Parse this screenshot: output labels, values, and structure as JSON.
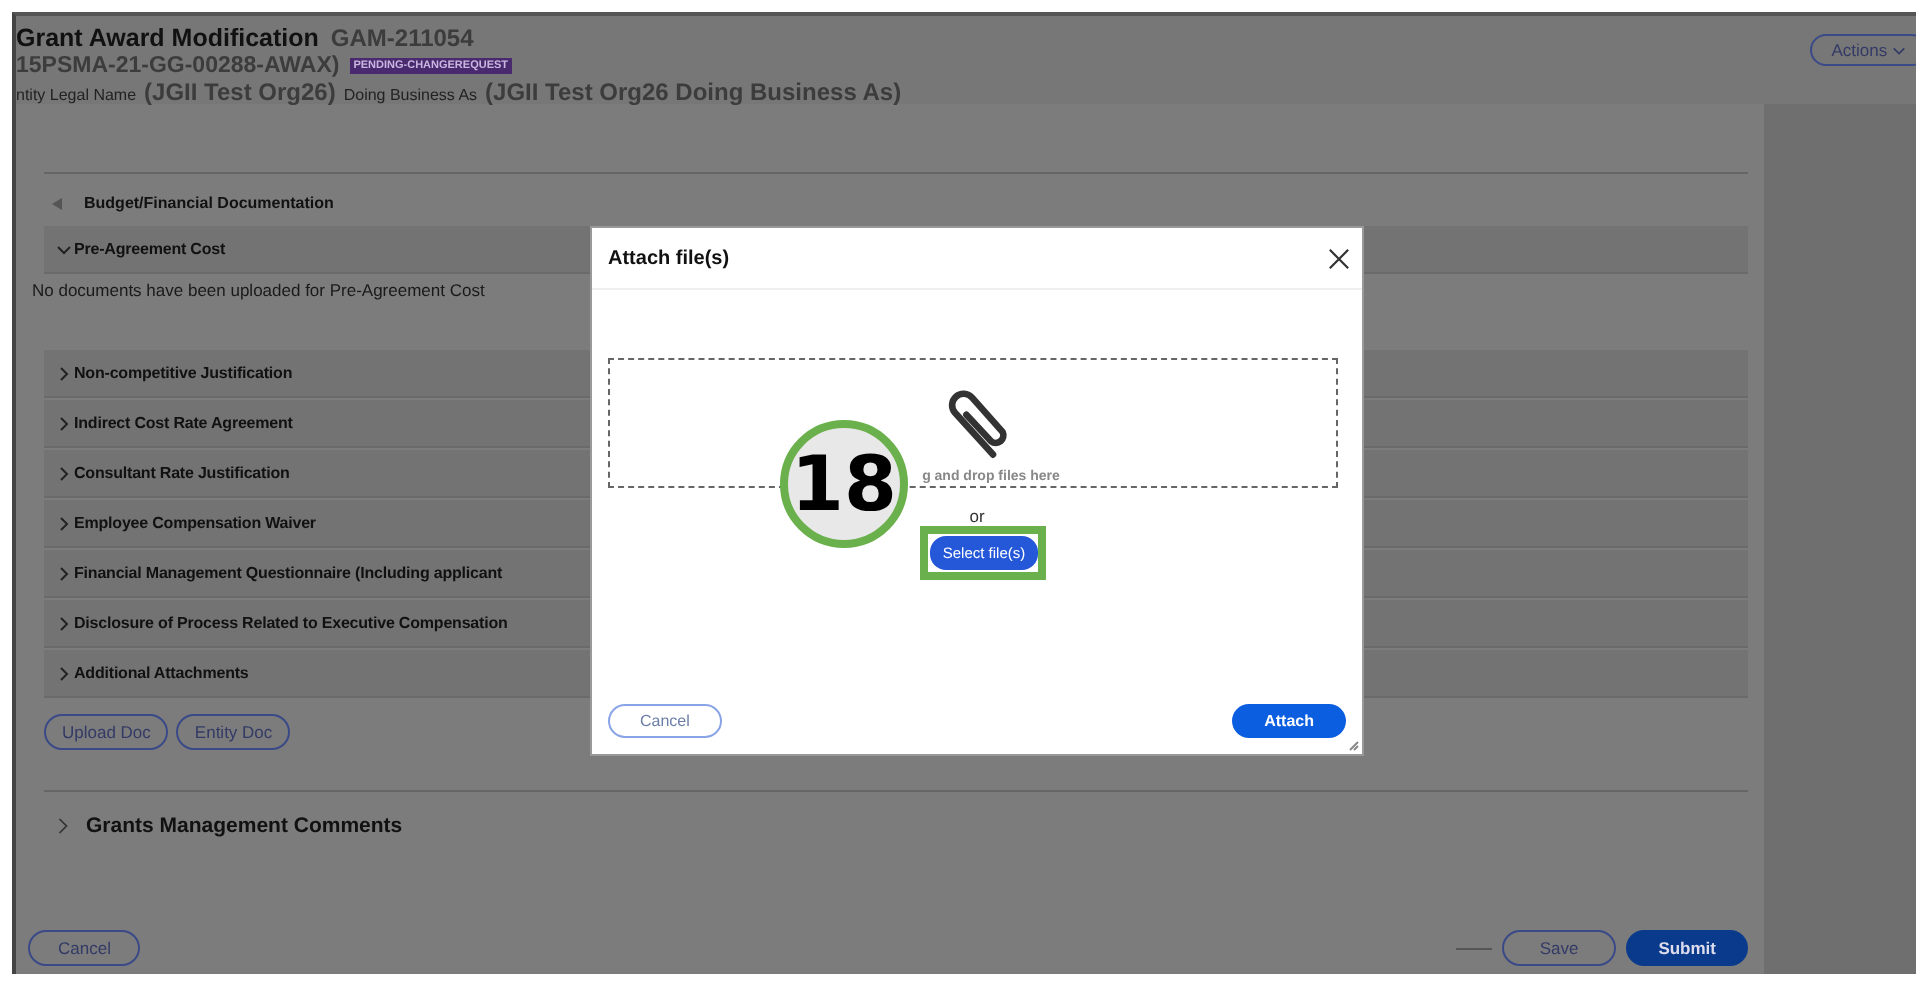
{
  "header": {
    "title": "Grant Award Modification",
    "record_id": "GAM-211054",
    "award_number": "15PSMA-21-GG-00288-AWAX)",
    "status_badge": "PENDING-CHANGEREQUEST",
    "legal_name_label": "ntity Legal Name",
    "legal_name": "(JGII Test Org26)",
    "dba_label": "Doing Business As",
    "dba": "(JGII Test Org26 Doing Business As)",
    "actions_button": "Actions"
  },
  "section": {
    "title": "Budget/Financial Documentation",
    "expanded": true
  },
  "accordion": [
    {
      "label": "Pre-Agreement Cost",
      "expanded": true,
      "message": "No documents have been uploaded for Pre-Agreement Cost"
    },
    {
      "label": "Non-competitive Justification",
      "expanded": false
    },
    {
      "label": "Indirect Cost Rate Agreement",
      "expanded": false
    },
    {
      "label": "Consultant Rate Justification",
      "expanded": false
    },
    {
      "label": "Employee Compensation Waiver",
      "expanded": false
    },
    {
      "label": "Financial Management Questionnaire (Including applicant",
      "expanded": false
    },
    {
      "label": "Disclosure of Process Related to Executive Compensation",
      "expanded": false
    },
    {
      "label": "Additional Attachments",
      "expanded": false
    }
  ],
  "doc_buttons": [
    "Upload Doc",
    "Entity Doc"
  ],
  "comments_section": {
    "title": "Grants Management Comments",
    "expanded": false
  },
  "footer": {
    "cancel": "Cancel",
    "save": "Save",
    "submit": "Submit"
  },
  "modal": {
    "title": "Attach file(s)",
    "drop_text": "g and drop files here",
    "or_text": "or",
    "select_button": "Select file(s)",
    "cancel": "Cancel",
    "attach": "Attach"
  },
  "callout": {
    "number": "18"
  }
}
